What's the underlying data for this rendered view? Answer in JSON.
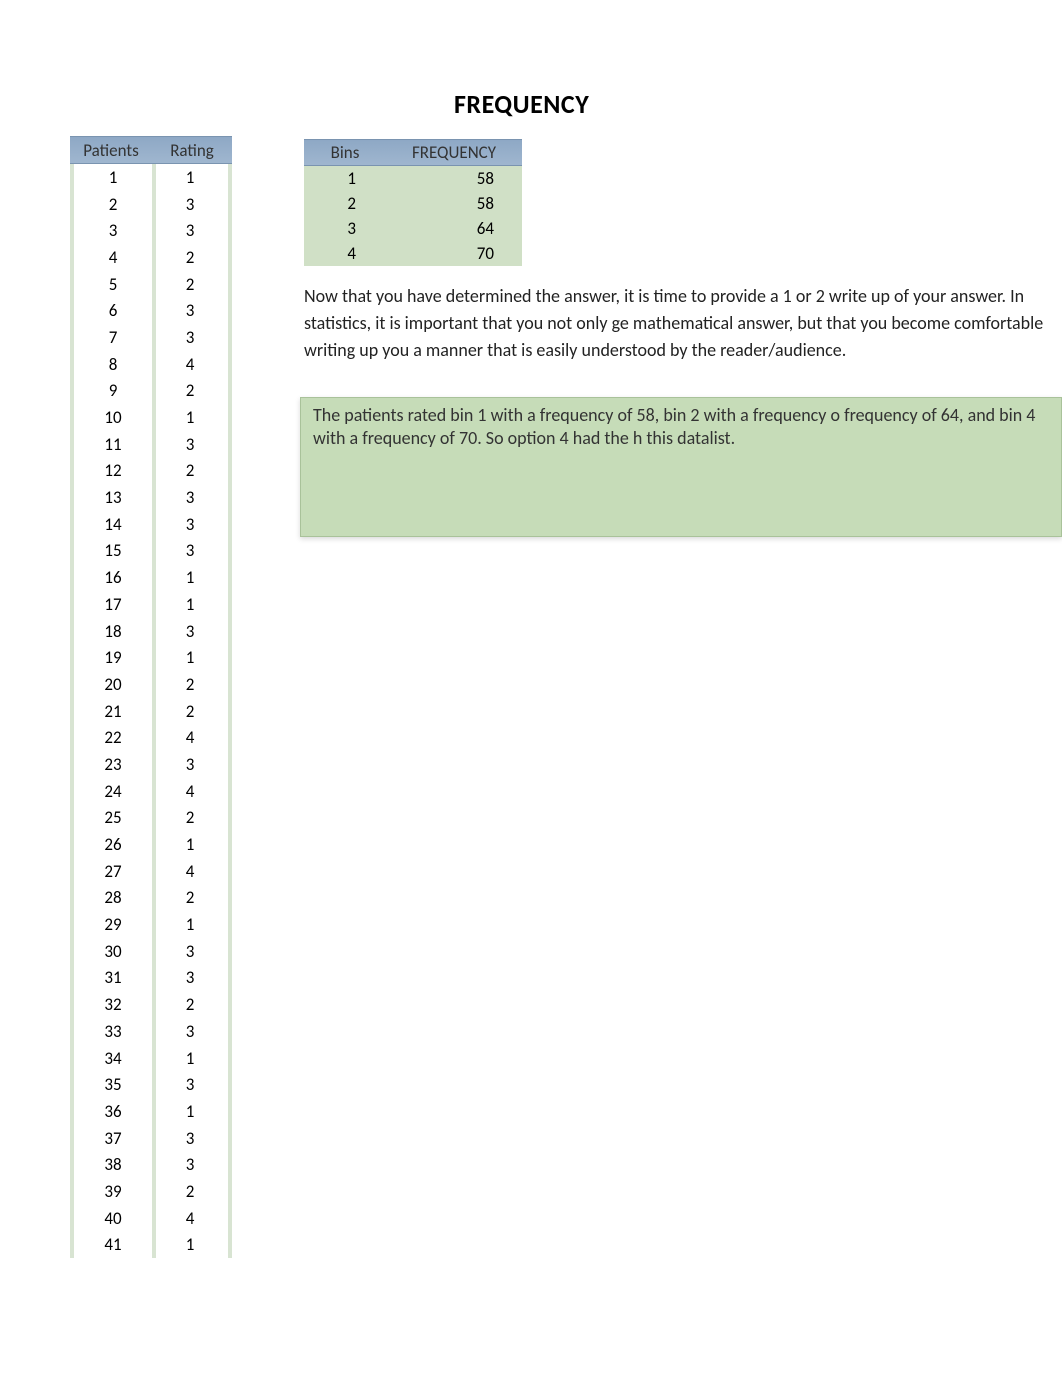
{
  "title": "FREQUENCY",
  "patients_table": {
    "header_patients": "Patients",
    "header_rating": "Rating",
    "rows": [
      {
        "p": "1",
        "r": "1"
      },
      {
        "p": "2",
        "r": "3"
      },
      {
        "p": "3",
        "r": "3"
      },
      {
        "p": "4",
        "r": "2"
      },
      {
        "p": "5",
        "r": "2"
      },
      {
        "p": "6",
        "r": "3"
      },
      {
        "p": "7",
        "r": "3"
      },
      {
        "p": "8",
        "r": "4"
      },
      {
        "p": "9",
        "r": "2"
      },
      {
        "p": "10",
        "r": "1"
      },
      {
        "p": "11",
        "r": "3"
      },
      {
        "p": "12",
        "r": "2"
      },
      {
        "p": "13",
        "r": "3"
      },
      {
        "p": "14",
        "r": "3"
      },
      {
        "p": "15",
        "r": "3"
      },
      {
        "p": "16",
        "r": "1"
      },
      {
        "p": "17",
        "r": "1"
      },
      {
        "p": "18",
        "r": "3"
      },
      {
        "p": "19",
        "r": "1"
      },
      {
        "p": "20",
        "r": "2"
      },
      {
        "p": "21",
        "r": "2"
      },
      {
        "p": "22",
        "r": "4"
      },
      {
        "p": "23",
        "r": "3"
      },
      {
        "p": "24",
        "r": "4"
      },
      {
        "p": "25",
        "r": "2"
      },
      {
        "p": "26",
        "r": "1"
      },
      {
        "p": "27",
        "r": "4"
      },
      {
        "p": "28",
        "r": "2"
      },
      {
        "p": "29",
        "r": "1"
      },
      {
        "p": "30",
        "r": "3"
      },
      {
        "p": "31",
        "r": "3"
      },
      {
        "p": "32",
        "r": "2"
      },
      {
        "p": "33",
        "r": "3"
      },
      {
        "p": "34",
        "r": "1"
      },
      {
        "p": "35",
        "r": "3"
      },
      {
        "p": "36",
        "r": "1"
      },
      {
        "p": "37",
        "r": "3"
      },
      {
        "p": "38",
        "r": "3"
      },
      {
        "p": "39",
        "r": "2"
      },
      {
        "p": "40",
        "r": "4"
      },
      {
        "p": "41",
        "r": "1"
      }
    ]
  },
  "bins_table": {
    "header_bins": "Bins",
    "header_freq": "FREQUENCY",
    "rows": [
      {
        "b": "1",
        "f": "58"
      },
      {
        "b": "2",
        "f": "58"
      },
      {
        "b": "3",
        "f": "64"
      },
      {
        "b": "4",
        "f": "70"
      }
    ]
  },
  "paragraph": "Now that you have determined the answer, it is time to provide a 1 or 2 write up of your answer. In statistics, it is important that you not only ge mathematical answer, but that you become comfortable writing up you a manner that is easily understood by the reader/audience.",
  "callout": "The patients rated bin 1 with a frequency of 58, bin 2 with a frequency o frequency of 64, and bin 4 with a frequency of 70. So option 4 had the h this datalist."
}
